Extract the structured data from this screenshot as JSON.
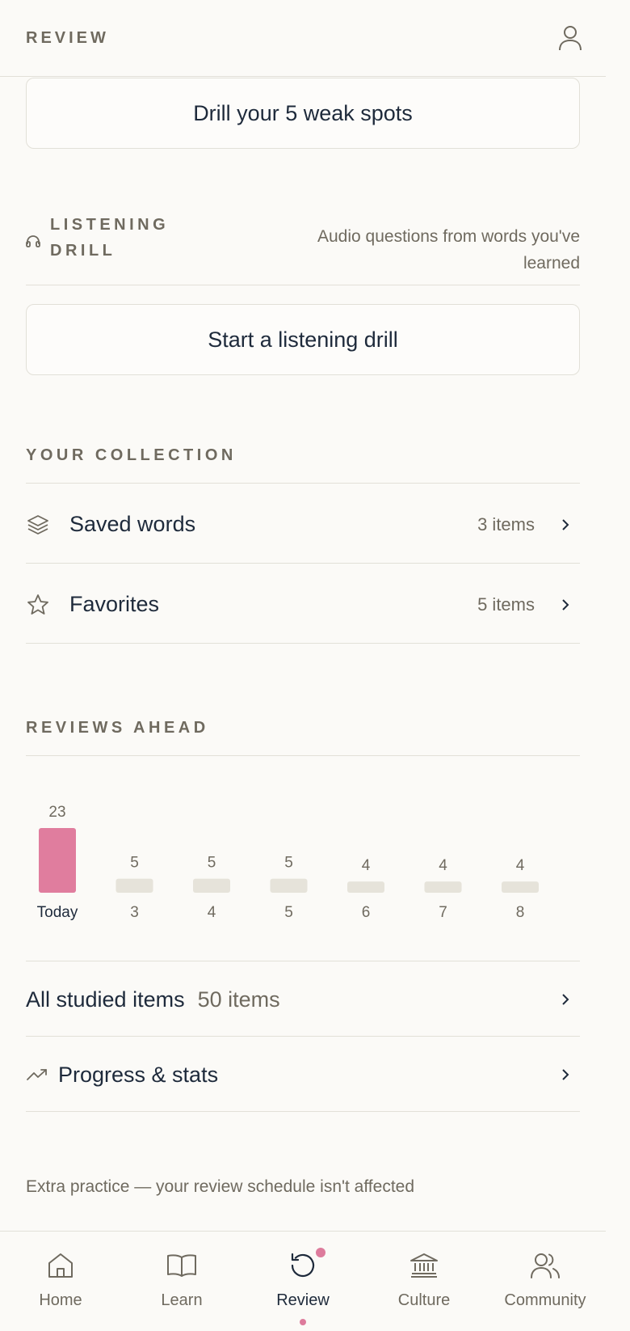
{
  "header": {
    "title": "REVIEW"
  },
  "weak_spots": {
    "button_label": "Drill your 5 weak spots"
  },
  "listening": {
    "title_line1": "LISTENING",
    "title_line2": "DRILL",
    "description": "Audio questions from words you've learned",
    "button_label": "Start a listening drill"
  },
  "collection": {
    "label": "YOUR COLLECTION",
    "items": [
      {
        "label": "Saved words",
        "count": "3 items",
        "icon": "layers-icon"
      },
      {
        "label": "Favorites",
        "count": "5 items",
        "icon": "star-icon"
      }
    ]
  },
  "reviews_ahead": {
    "label": "REVIEWS AHEAD"
  },
  "chart_data": {
    "type": "bar",
    "categories": [
      "Today",
      "3",
      "4",
      "5",
      "6",
      "7",
      "8"
    ],
    "values": [
      23,
      5,
      5,
      5,
      4,
      4,
      4
    ],
    "highlight_color": "#e07d9e",
    "bar_color": "#e6e3da",
    "highlight_index": 0
  },
  "all_studied": {
    "label": "All studied items",
    "count": "50 items"
  },
  "progress": {
    "label": "Progress & stats",
    "icon": "trending-up-icon"
  },
  "footnote": "Extra practice — your review schedule isn't affected",
  "nav": {
    "items": [
      {
        "label": "Home",
        "icon": "home-icon"
      },
      {
        "label": "Learn",
        "icon": "book-icon"
      },
      {
        "label": "Review",
        "icon": "refresh-icon",
        "active": true
      },
      {
        "label": "Culture",
        "icon": "museum-icon"
      },
      {
        "label": "Community",
        "icon": "users-icon"
      }
    ]
  },
  "colors": {
    "accent": "#dd7b9c",
    "text": "#1e2a3b",
    "muted": "#6f6a5f",
    "divider": "#e2e0d8"
  }
}
